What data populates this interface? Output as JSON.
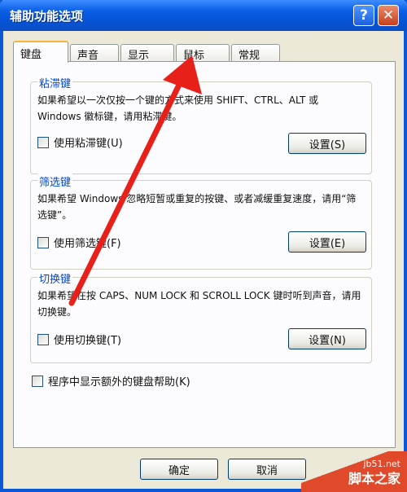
{
  "window": {
    "title": "辅助功能选项"
  },
  "titlebar": {
    "help_label": "?",
    "close_label": "✕"
  },
  "tabs": [
    {
      "label": "键盘",
      "active": true
    },
    {
      "label": "声音",
      "active": false
    },
    {
      "label": "显示",
      "active": false
    },
    {
      "label": "鼠标",
      "active": false
    },
    {
      "label": "常规",
      "active": false
    }
  ],
  "groups": {
    "sticky": {
      "title": "粘滞键",
      "desc": "如果希望以一次仅按一个键的方式来使用 SHIFT、CTRL、ALT 或 Windows 徽标键，请用粘滞键。",
      "checkbox_label": "使用粘滞键(U)",
      "settings_label": "设置(S)"
    },
    "filter": {
      "title": "筛选键",
      "desc": "如果希望 Windows 忽略短暂或重复的按键、或者减缓重复速度，请用“筛选键”。",
      "checkbox_label": "使用筛选键(F)",
      "settings_label": "设置(E)"
    },
    "toggle": {
      "title": "切换键",
      "desc": "如果希望在按 CAPS、NUM LOCK 和 SCROLL LOCK 键时听到声音，请用切换键。",
      "checkbox_label": "使用切换键(T)",
      "settings_label": "设置(N)"
    }
  },
  "extra_help": {
    "label": "程序中显示额外的键盘帮助(K)"
  },
  "footer": {
    "ok_label": "确定",
    "cancel_label": "取消"
  },
  "watermark": {
    "site": "jb51.net",
    "name": "脚本之家"
  },
  "colors": {
    "titlebar": "#0a5fe6",
    "group_title": "#0046d5",
    "arrow": "#e8201a",
    "watermark": "#e04a2a"
  }
}
